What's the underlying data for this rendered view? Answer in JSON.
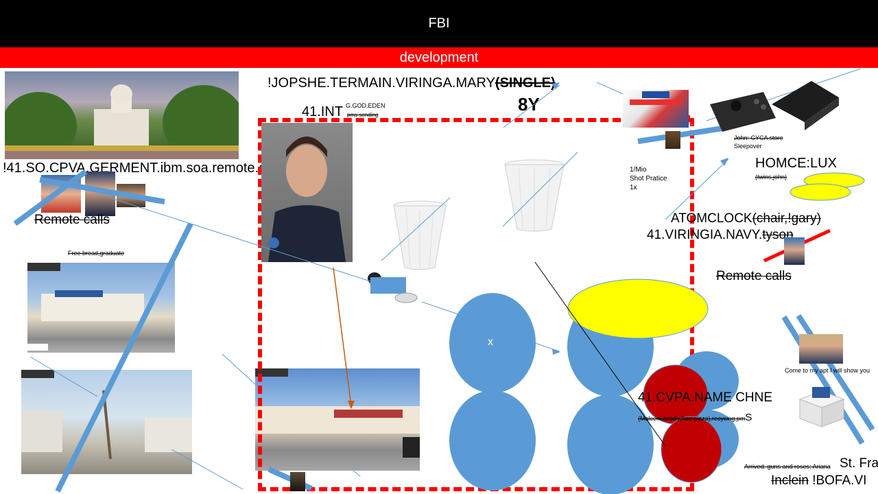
{
  "header": {
    "title": "FBI",
    "subtitle": "development"
  },
  "labels": {
    "jopshe_prefix": "!JOPSHE.TERMAIN.VIRINGA.MARY",
    "jopshe_single": "(SINGLE)",
    "eight_y": "8Y",
    "int_prefix": "41.INT",
    "int_sup": "G.GOD.EDEN",
    "int_sub": "pms sending",
    "so_cpva": "!41.SO.CPVA.GERMENT.ibm.soa.remote.ca...",
    "remote_calls_left": "Remote calls",
    "free_bread": "Free bread,graduate",
    "mio": "1/Mio",
    "shot_practice": "Shot Pratice",
    "one_x": "1x",
    "john_store": "John: CYCA store",
    "sleepover": "Sleepover",
    "homce": "HOMCE:LUX",
    "twins": "(twins,john)",
    "atomclock": "ATOMCLOCK",
    "atomclock_strike": "(chair,!gary)",
    "viringia_navy": "41.VIRINGIA.NAVY.",
    "tyson": "tyson",
    "remote_calls_right": "Remote calls",
    "come_to_apt": "Come to my apt I will show you",
    "cvpa_name": "41.CVPA.NAME CHNE",
    "malcom": "(Malcem,bradly,free pizza),recycing.pm",
    "malcom_s": "S",
    "arrived": "Arrived: guns and roses; Ariana",
    "st_fra": "St. Fra",
    "inclein": "Inclein",
    "bofa": " !BOFA.VI",
    "circle_x": "x"
  },
  "icons": {
    "capitol": "capitol-building-photo",
    "officer": "police-officer-photo",
    "cup1": "paper-cup-icon",
    "cup2": "paper-cup-icon",
    "sega": "sega-master-system-box",
    "neogeo": "game-console-photo",
    "robot": "robot-vacuum-icon",
    "gift": "gift-box-icon"
  },
  "colors": {
    "header_bg": "#000000",
    "dev_bg": "#ff0000",
    "circle_blue": "#5b9bd5",
    "circle_red": "#c00000",
    "yellow": "#ffff00",
    "dash_red": "#ff0000",
    "slash_blue": "#5b9bd5"
  }
}
